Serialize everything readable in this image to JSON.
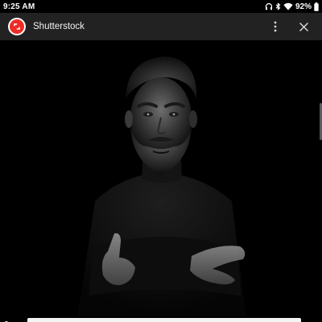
{
  "status_bar": {
    "time": "9:25 AM",
    "battery_percent": "92%",
    "icons": [
      "headphones-icon",
      "bluetooth-icon",
      "wifi-icon",
      "battery-icon"
    ]
  },
  "app_bar": {
    "title": "Shutterstock",
    "logo_icon": "shutterstock-logo-icon",
    "more_icon": "more-vert-icon",
    "close_icon": "close-icon"
  },
  "content": {
    "image_icon": "photo-image"
  },
  "colors": {
    "brand": "#ee2b24",
    "app_bar": "#222222",
    "background": "#000000"
  }
}
